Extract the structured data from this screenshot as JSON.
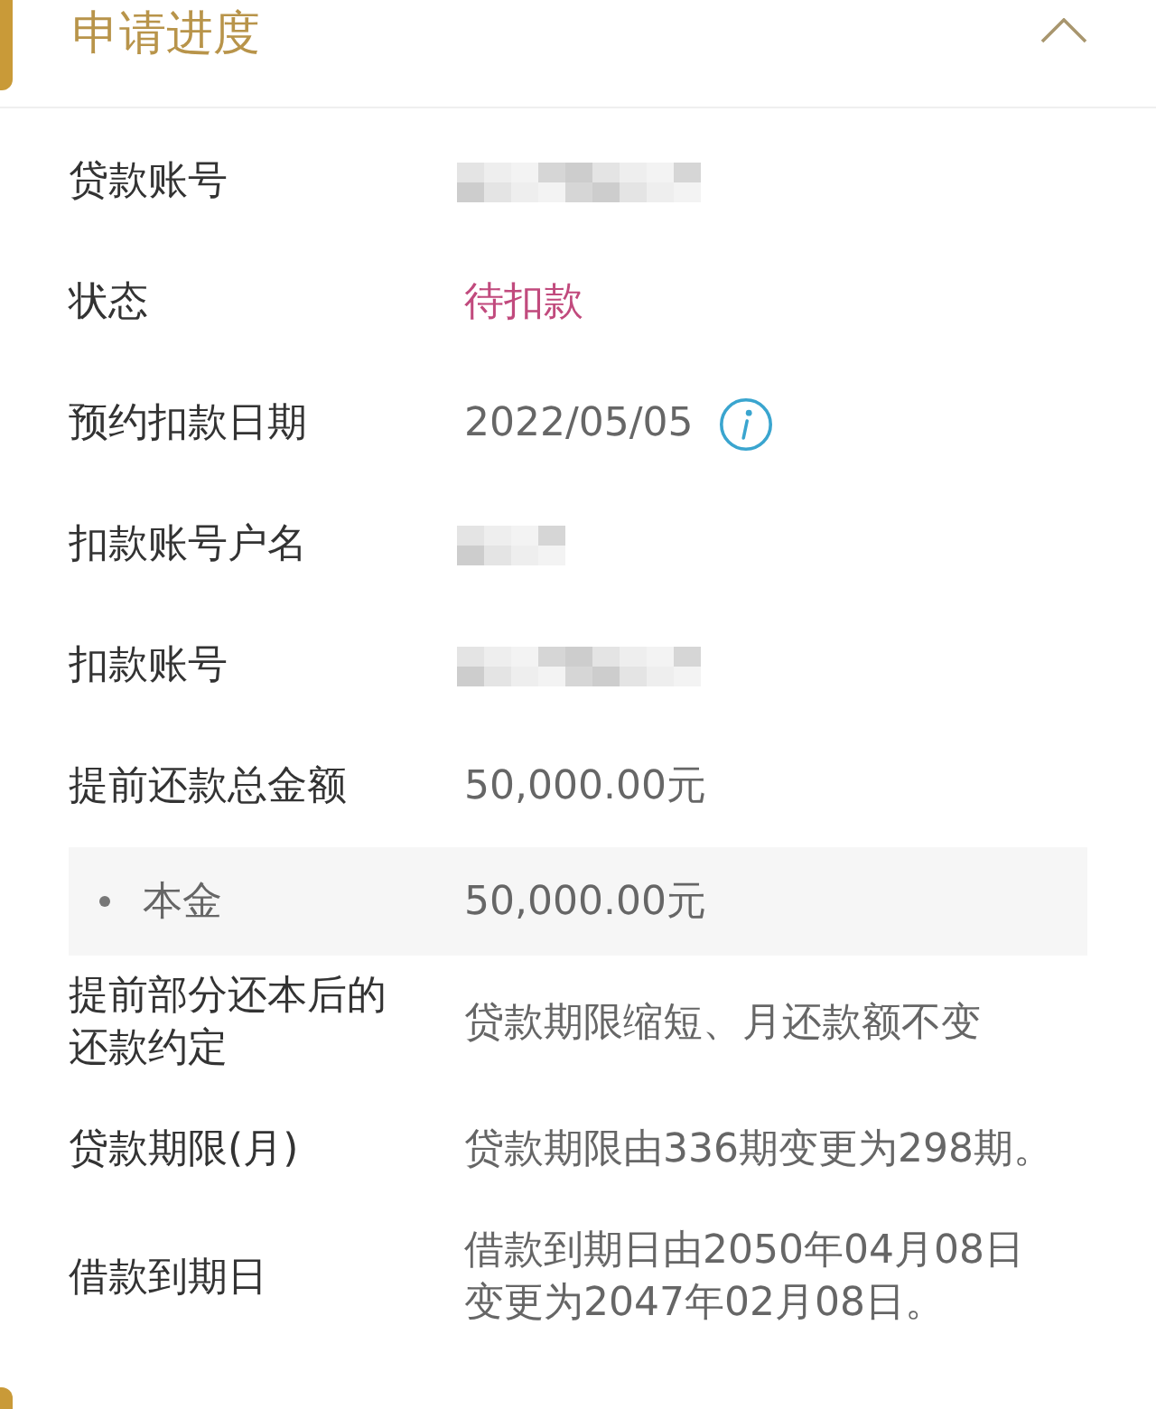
{
  "section": {
    "title": "申请进度",
    "expanded": true
  },
  "rows": [
    {
      "kind": "masked",
      "label": "贷款账号",
      "short": false
    },
    {
      "kind": "status",
      "label": "状态",
      "value": "待扣款"
    },
    {
      "kind": "info",
      "label": "预约扣款日期",
      "value": "2022/05/05"
    },
    {
      "kind": "masked",
      "label": "扣款账号户名",
      "short": true
    },
    {
      "kind": "masked",
      "label": "扣款账号",
      "short": false
    },
    {
      "kind": "text",
      "label": "提前还款总金额",
      "value": "50,000.00元",
      "children": [
        {
          "label": "本金",
          "value": "50,000.00元"
        }
      ]
    },
    {
      "kind": "text",
      "label": "提前部分还本后的还款约定",
      "value": "贷款期限缩短、月还款额不变"
    },
    {
      "kind": "text",
      "label": "贷款期限(月)",
      "value": "贷款期限由336期变更为298期。"
    },
    {
      "kind": "text",
      "label": "借款到期日",
      "value": "借款到期日由2050年04月08日变更为2047年02月08日。"
    }
  ]
}
